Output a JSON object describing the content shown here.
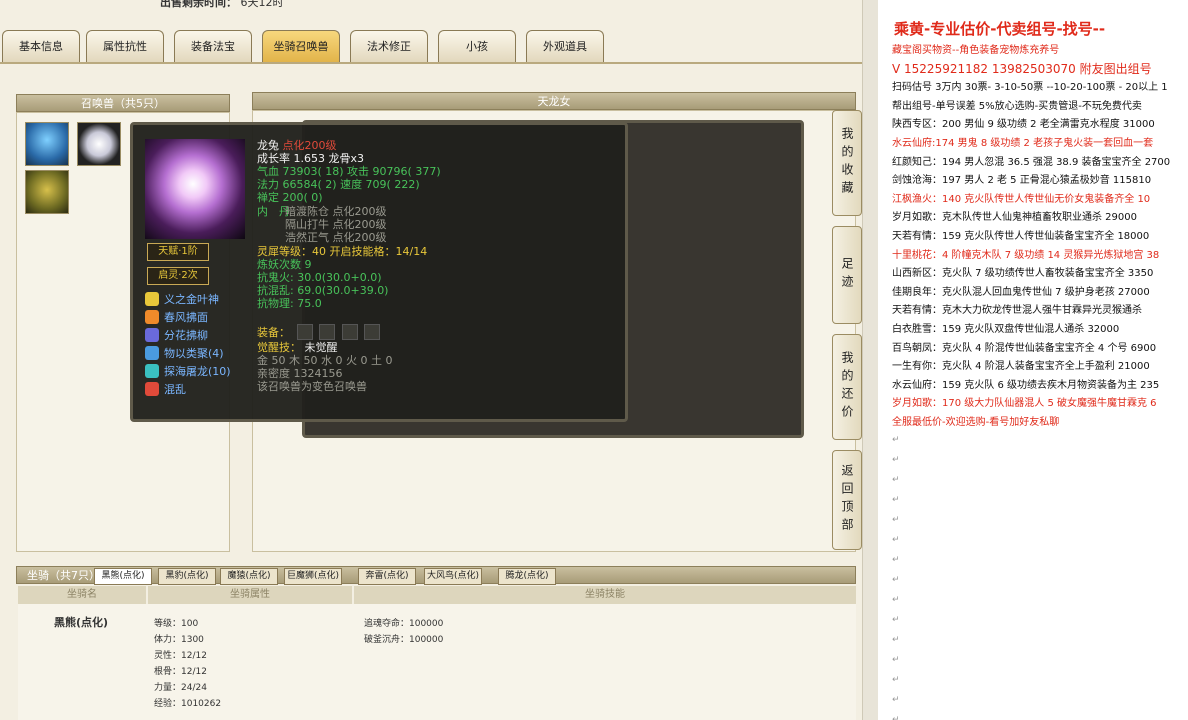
{
  "sale_time": {
    "label": "出售剩余时间：",
    "value": "6天12时"
  },
  "tabs": [
    {
      "label": "基本信息"
    },
    {
      "label": "属性抗性"
    },
    {
      "label": "装备法宝"
    },
    {
      "label": "坐骑召唤兽"
    },
    {
      "label": "法术修正"
    },
    {
      "label": "小孩"
    },
    {
      "label": "外观道具"
    }
  ],
  "pet_panel": {
    "title": "召唤兽（共5只）"
  },
  "right_panel": {
    "title": "天龙女"
  },
  "tooltip": {
    "name": "龙兔",
    "name_suffix": "点化200级",
    "growth": "成长率 1.653 龙骨x3",
    "hp": "气血 73903( 18) 攻击 90796( 377)",
    "mp": "法力 66584( 2) 速度 709( 222)",
    "zen": "禅定 200( 0)",
    "neidan_label": "内　丹",
    "neidan": [
      "暗渡陈仓 点化200级",
      "隔山打牛 点化200级",
      "浩然正气 点化200级"
    ],
    "spirit": "灵犀等级：40 开启技能格：14/14",
    "refine": "炼妖次数 9",
    "resist": [
      "抗鬼火: 30.0(30.0+0.0)",
      "抗混乱: 69.0(30.0+39.0)",
      "抗物理: 75.0"
    ],
    "badge1": "天赋·1阶",
    "badge2": "启灵·2次",
    "skills": [
      "义之金叶神",
      "春风拂面",
      "分花拂柳",
      "物以类聚(4)",
      "探海屠龙(10)",
      "混乱"
    ],
    "skill_colors": [
      "#e8c73a",
      "#f08a2a",
      "#6a6adb",
      "#4a9be0",
      "#3ac0c0",
      "#e04a3a"
    ],
    "equip_label": "装备：",
    "awaken": "觉醒技：",
    "awaken_value": "未觉醒",
    "elements": "金 50 木 50 水 0 火 0 土 0",
    "intimacy": "亲密度 1324156",
    "note": "该召唤兽为变色召唤兽"
  },
  "sidenav": [
    "我的收藏",
    "足迹",
    "我的还价",
    "返回顶部"
  ],
  "mount": {
    "title": "坐骑（共7只）",
    "tabs": [
      "黑熊(点化)",
      "黑豹(点化)",
      "魔猿(点化)",
      "巨魔狮(点化)",
      "奔雷(点化)",
      "大风鸟(点化)",
      "腾龙(点化)"
    ],
    "col_name": "坐骑名",
    "col_attr": "坐骑属性",
    "col_skill": "坐骑技能",
    "name": "黑熊(点化)",
    "stats": [
      "等级：100",
      "体力：1300",
      "灵性：12/12",
      "根骨：12/12",
      "力量：24/24",
      "经验：1010262"
    ],
    "skills": [
      "追魂夺命：100000",
      "破釜沉舟：100000"
    ]
  },
  "chat": {
    "title": "乘黄-专业估价-代卖组号-找号--",
    "lines": [
      {
        "text": "藏宝阁买物资--角色装备宠物炼充养号",
        "color": "red"
      },
      {
        "text": "V 15225921182 13982503070 附友图出组号",
        "color": "red",
        "big": true
      },
      {
        "text": "扫码估号 3万内 30票- 3-10-50票 --10-20-100票 - 20以上 1",
        "color": "black"
      },
      {
        "text": "帮出组号-单号误差 5%放心选购-买贵管退-不玩免费代卖",
        "color": "black"
      },
      {
        "text": "陕西专区：200 男仙 9 级功绩 2 老全满雷克水程度 31000",
        "color": "black"
      },
      {
        "text": "水云仙府:174 男鬼 8 级功绩 2 老孩子鬼火装一套回血一套",
        "color": "red"
      },
      {
        "text": "红颜知己：194 男人忽混 36.5 强混 38.9 装备宝宝齐全 2700",
        "color": "black"
      },
      {
        "text": "剑蚀沧海：197 男人 2 老 5 正骨混心猿孟极妙音 115810",
        "color": "black"
      },
      {
        "text": "江枫渔火：140 克火队传世人传世仙无价女鬼装备齐全 10",
        "color": "red"
      },
      {
        "text": "岁月如歌：克木队传世人仙鬼神植畜牧职业通杀 29000",
        "color": "black"
      },
      {
        "text": "天若有情：159 克火队传世人传世仙装备宝宝齐全 18000",
        "color": "black"
      },
      {
        "text": "十里桃花：4 阶幢克木队 7 级功绩 14 灵猴异光炼狱地宫 38",
        "color": "red"
      },
      {
        "text": "山西新区：克火队 7 级功绩传世人畜牧装备宝宝齐全 3350",
        "color": "black"
      },
      {
        "text": "佳期良年：克火队混人回血鬼传世仙 7 级护身老孩 27000",
        "color": "black"
      },
      {
        "text": "天若有情：克木大力砍龙传世混人强牛甘霖异光灵猴通杀",
        "color": "black"
      },
      {
        "text": "白衣胜雪：159 克火队双盘传世仙混人通杀 32000",
        "color": "black"
      },
      {
        "text": "百鸟朝凤：克火队 4 阶混传世仙装备宝宝齐全 4 个号 6900",
        "color": "black"
      },
      {
        "text": "一生有你：克火队 4 阶混人装备宝宝齐全上手盈利 21000",
        "color": "black"
      },
      {
        "text": "水云仙府：159 克火队 6 级功绩去疾木月物资装备为主 235",
        "color": "black"
      },
      {
        "text": "岁月如歌：170 级大力队仙器混人 5 破女魔强牛魔甘霖克 6",
        "color": "red"
      },
      {
        "text": "全服最低价-欢迎选购-看号加好友私聊",
        "color": "red"
      }
    ],
    "para_mark": "↵"
  }
}
